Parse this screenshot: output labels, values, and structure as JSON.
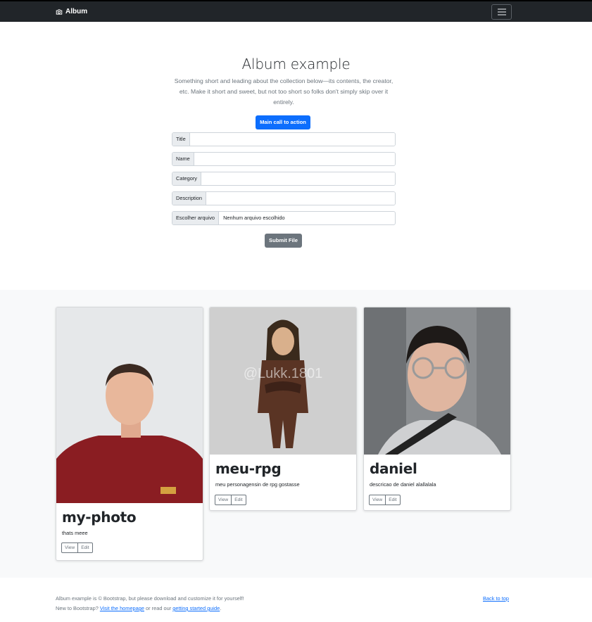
{
  "navbar": {
    "brand": "Album"
  },
  "hero": {
    "title": "Album example",
    "lead": "Something short and leading about the collection below—its contents, the creator, etc. Make it short and sweet, but not too short so folks don't simply skip over it entirely.",
    "cta_label": "Main call to action"
  },
  "form": {
    "title_label": "Title",
    "name_label": "Name",
    "category_label": "Category",
    "description_label": "Description",
    "file_label": "Escolher arquivo",
    "file_value": "Nenhum arquivo escolhido",
    "submit_label": "Submit File"
  },
  "cards": [
    {
      "title": "my-photo",
      "text": "thats meee",
      "view": "View",
      "edit": "Edit"
    },
    {
      "title": "meu-rpg",
      "text": "meu personagensin de rpg gostasse",
      "view": "View",
      "edit": "Edit",
      "watermark": "@Lukk.1801"
    },
    {
      "title": "daniel",
      "text": "descricao de daniel alallalala",
      "view": "View",
      "edit": "Edit"
    }
  ],
  "footer": {
    "line1": "Album example is © Bootstrap, but please download and customize it for yourself!",
    "line2_prefix": "New to Bootstrap? ",
    "homepage_link": "Visit the homepage",
    "line2_mid": " or read our ",
    "guide_link": "getting started guide",
    "line2_suffix": ".",
    "back_to_top": "Back to top"
  },
  "colors": {
    "primary": "#0d6efd",
    "secondary": "#6c757d",
    "dark": "#212529",
    "light": "#f8f9fa"
  }
}
